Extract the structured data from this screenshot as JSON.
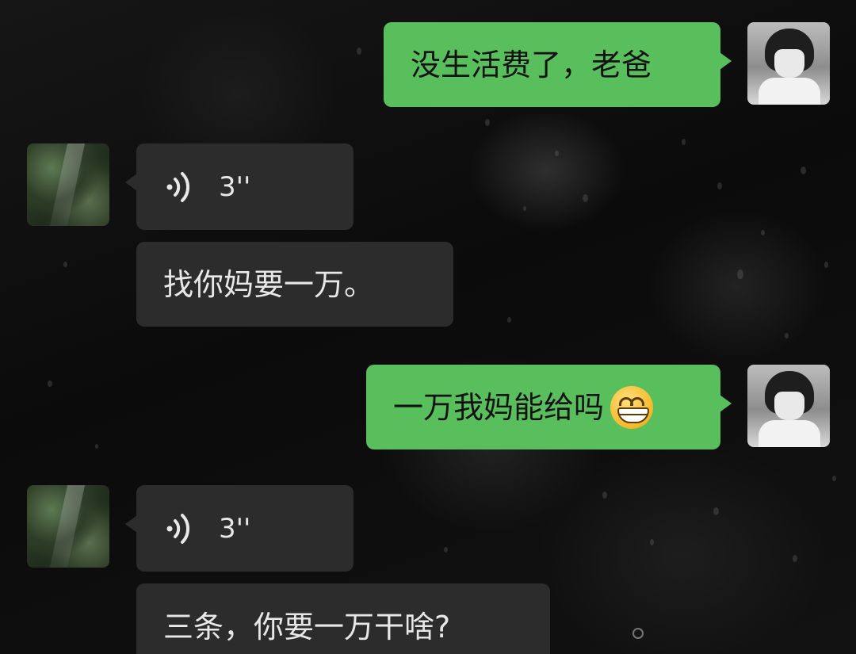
{
  "chat": {
    "messages": [
      {
        "sender": "me",
        "type": "text",
        "text": "没生活费了，老爸"
      },
      {
        "sender": "other",
        "type": "voice",
        "duration": "3''"
      },
      {
        "sender": "other",
        "type": "text",
        "text": "找你妈要一万。"
      },
      {
        "sender": "me",
        "type": "text",
        "text": "一万我妈能给吗",
        "emoji": "grinning-face-emoji"
      },
      {
        "sender": "other",
        "type": "voice",
        "duration": "3''"
      },
      {
        "sender": "other",
        "type": "text",
        "text": "三条，你要一万干啥?"
      }
    ]
  },
  "colors": {
    "my_bubble": "#58bf5c",
    "other_bubble": "#2c2c2c",
    "background": "#0e0e0e"
  },
  "icons": {
    "voice": "voice-message-icon",
    "my_avatar": "anime-boy-avatar",
    "other_avatar": "landscape-avatar"
  }
}
